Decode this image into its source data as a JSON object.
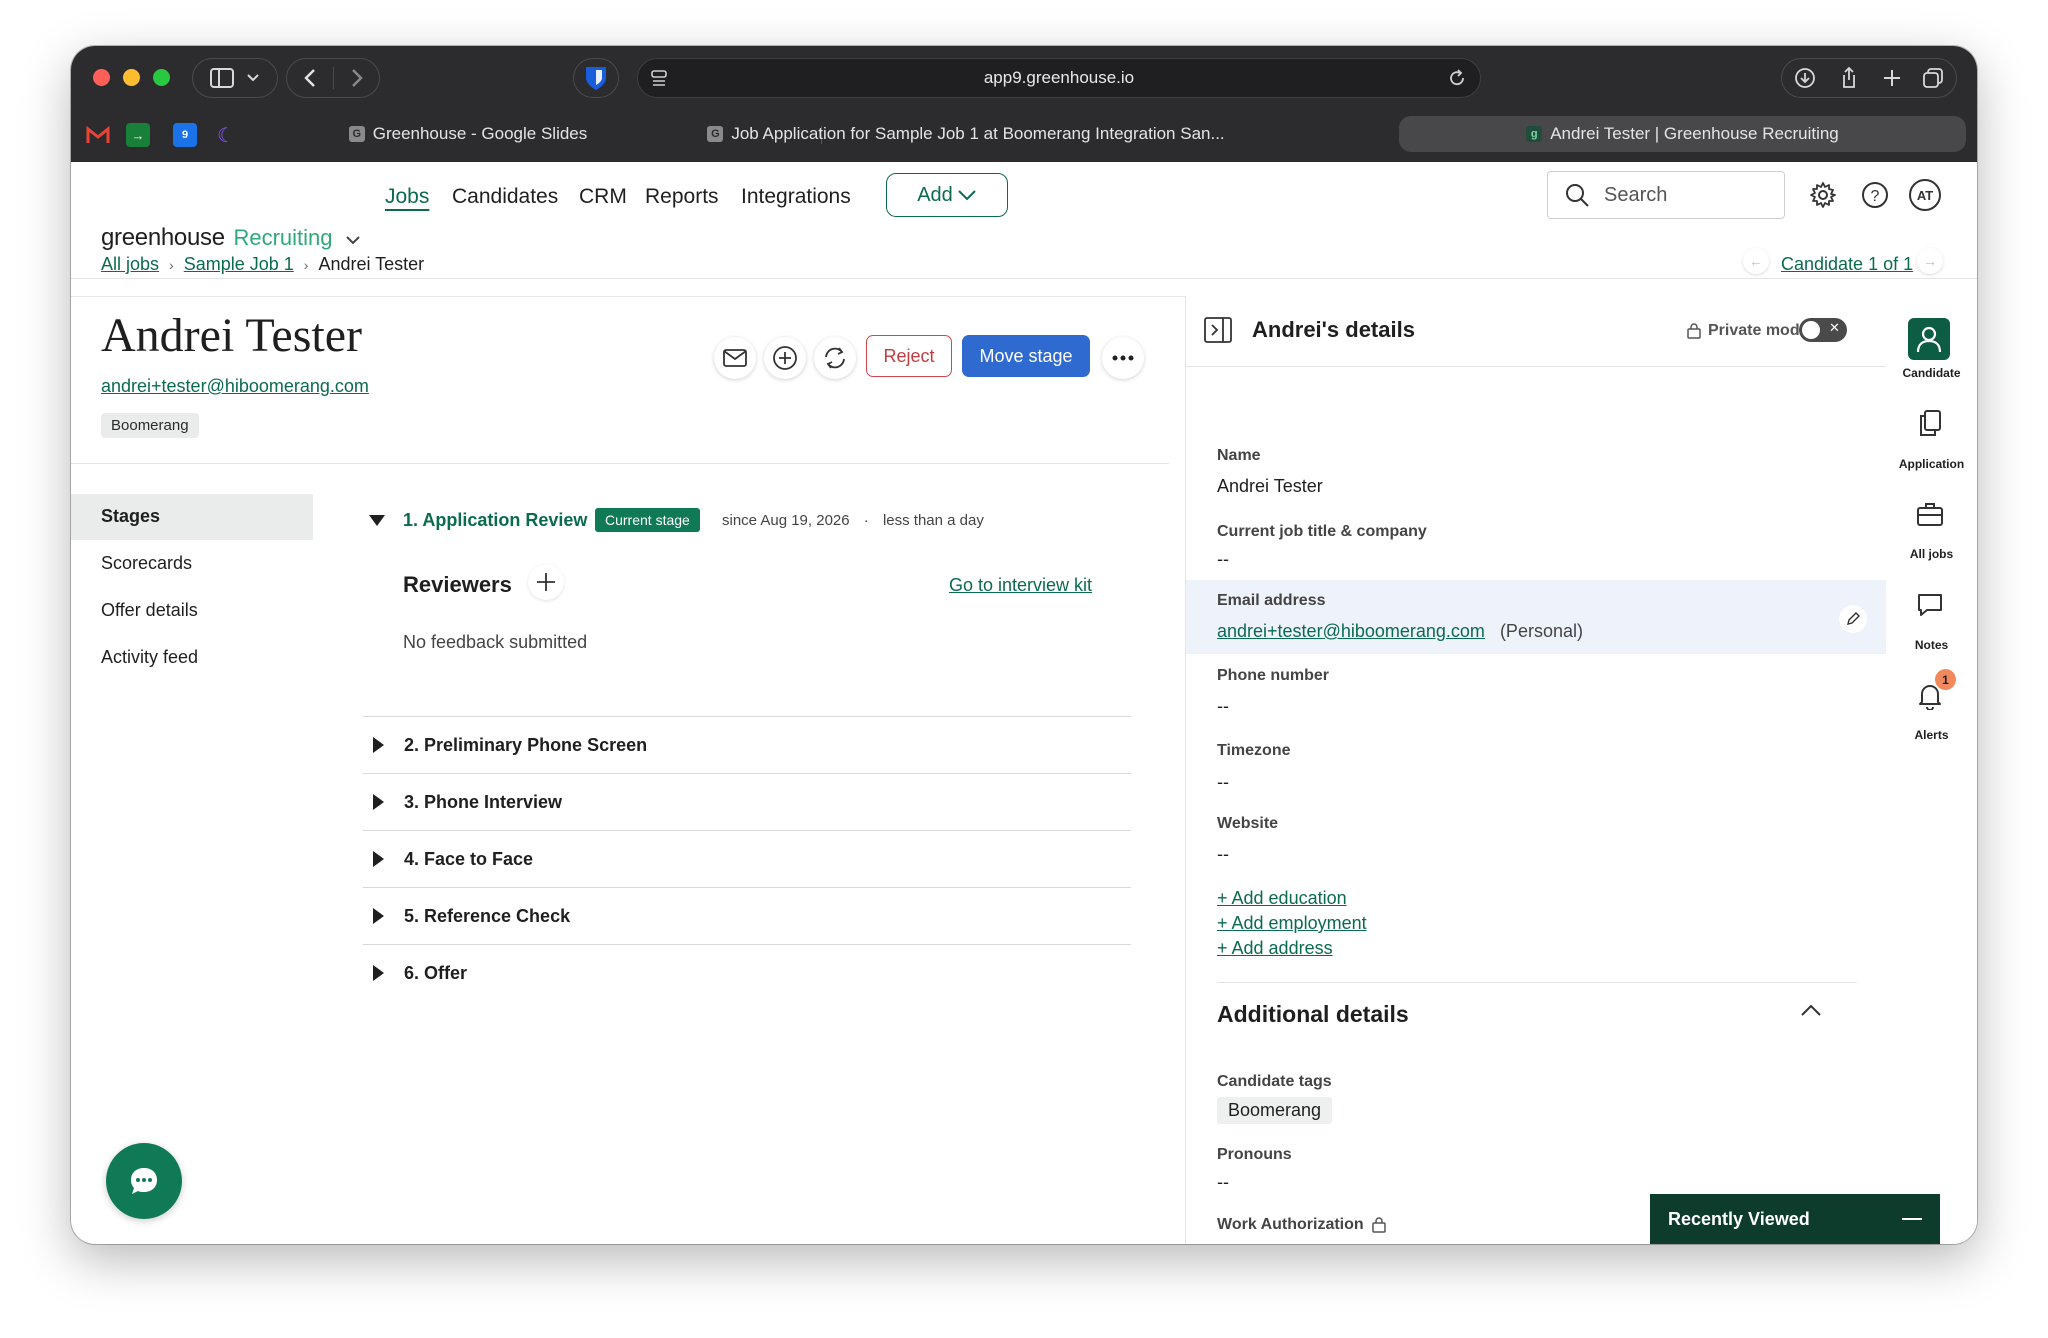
{
  "browser": {
    "url": "app9.greenhouse.io",
    "tabs": [
      {
        "label": "Greenhouse - Google Slides",
        "favicon": "G"
      },
      {
        "label": "Job Application for Sample Job 1 at Boomerang Integration San...",
        "favicon": "G"
      },
      {
        "label": "Andrei Tester | Greenhouse Recruiting",
        "favicon": "g"
      }
    ]
  },
  "app": {
    "brand_main": "greenhouse",
    "brand_sub": "Recruiting",
    "nav": [
      "Jobs",
      "Candidates",
      "CRM",
      "Reports",
      "Integrations"
    ],
    "add_label": "Add",
    "search_placeholder": "Search",
    "avatar_initials": "AT"
  },
  "breadcrumb": {
    "all_jobs": "All jobs",
    "job": "Sample Job 1",
    "current": "Andrei Tester",
    "candidate_pager": "Candidate 1 of 1"
  },
  "candidate": {
    "name": "Andrei Tester",
    "email": "andrei+tester@hiboomerang.com",
    "tag": "Boomerang",
    "reject_label": "Reject",
    "move_label": "Move stage"
  },
  "sidebar": [
    "Stages",
    "Scorecards",
    "Offer details",
    "Activity feed"
  ],
  "current_stage": {
    "title": "1. Application Review",
    "badge": "Current stage",
    "since": "since Aug 19, 2026",
    "duration": "less than a day",
    "reviewers_label": "Reviewers",
    "kit_link": "Go to interview kit",
    "no_feedback": "No feedback submitted"
  },
  "stages": [
    "2. Preliminary Phone Screen",
    "3. Phone Interview",
    "4. Face to Face",
    "5. Reference Check",
    "6. Offer"
  ],
  "details": {
    "title": "Andrei's details",
    "private_mode": "Private mode",
    "name_label": "Name",
    "name_value": "Andrei Tester",
    "job_label": "Current job title & company",
    "job_value": "--",
    "email_label": "Email address",
    "email_value": "andrei+tester@hiboomerang.com",
    "email_type": "(Personal)",
    "phone_label": "Phone number",
    "phone_value": "--",
    "tz_label": "Timezone",
    "tz_value": "--",
    "website_label": "Website",
    "website_value": "--",
    "add_education": "+ Add education",
    "add_employment": "+ Add employment",
    "add_address": "+ Add address",
    "additional_title": "Additional details",
    "tags_label": "Candidate tags",
    "tags_value": "Boomerang",
    "pronouns_label": "Pronouns",
    "pronouns_value": "--",
    "work_auth_label": "Work Authorization",
    "work_auth_value": "--"
  },
  "rail": {
    "candidate": "Candidate",
    "application": "Application",
    "all_jobs": "All jobs",
    "notes": "Notes",
    "alerts": "Alerts",
    "alerts_count": "1"
  },
  "recently_viewed": "Recently Viewed",
  "colors": {
    "brand_green": "#0b6b4f",
    "stage_badge": "#0f7a55",
    "move_blue": "#2f6ad0",
    "reject_red": "#c23b3f",
    "chrome": "#2c2c2e"
  }
}
